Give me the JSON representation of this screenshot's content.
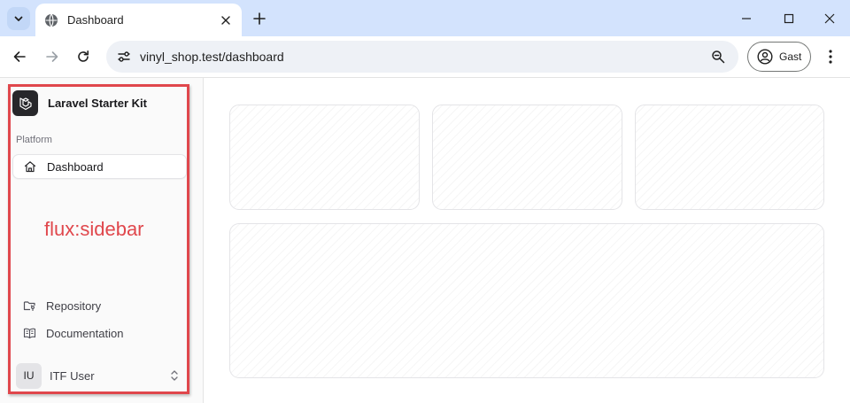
{
  "browser": {
    "tab_title": "Dashboard",
    "url": "vinyl_shop.test/dashboard",
    "profile_label": "Gast"
  },
  "sidebar": {
    "brand": "Laravel Starter Kit",
    "group_label": "Platform",
    "nav_items": [
      {
        "label": "Dashboard",
        "icon": "home-icon",
        "active": true
      }
    ],
    "annotation": "flux:sidebar",
    "footer_links": [
      {
        "label": "Repository",
        "icon": "folder-git-icon"
      },
      {
        "label": "Documentation",
        "icon": "book-open-icon"
      }
    ],
    "user": {
      "initials": "IU",
      "name": "ITF User"
    }
  },
  "colors": {
    "annotation": "#e0474c",
    "tabstrip": "#d3e3fd",
    "brand_logo": "#27272a"
  }
}
